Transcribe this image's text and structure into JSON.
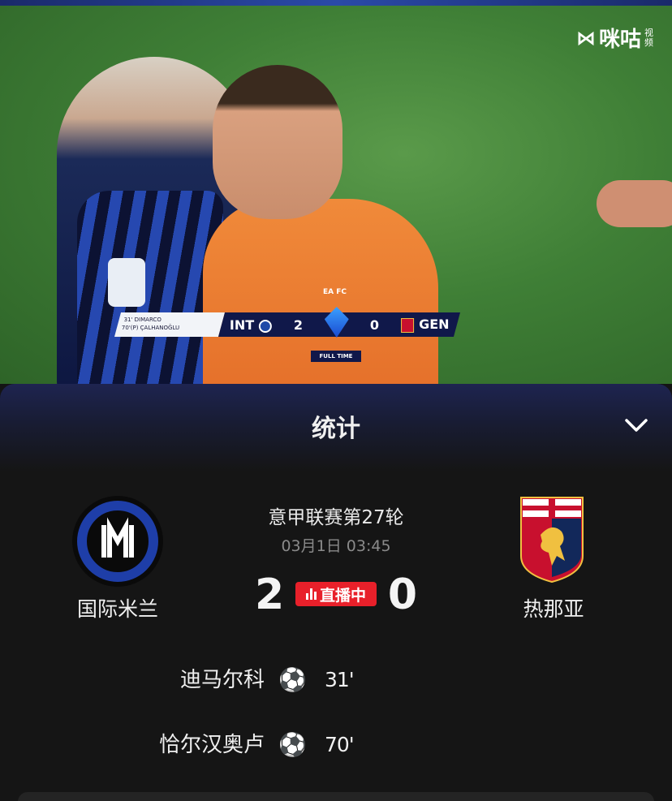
{
  "video": {
    "brand_text": "咪咕",
    "brand_sub": "视频",
    "scorebug": {
      "scorer1": "31'  DIMARCO",
      "scorer2": "70'(P)  ÇALHANOĞLU",
      "home_code": "INT",
      "home_score": "2",
      "away_score": "0",
      "away_code": "GEN",
      "status": "FULL TIME"
    }
  },
  "panel": {
    "title": "统计",
    "collapse_icon": "chevron-down-icon"
  },
  "match": {
    "competition": "意甲联赛第27轮",
    "datetime": "03月1日 03:45",
    "home_team": "国际米兰",
    "away_team": "热那亚",
    "home_score": "2",
    "away_score": "0",
    "live_label": "直播中",
    "colors": {
      "live": "#e8202a",
      "inter_blue": "#1e3ea8",
      "genoa_red": "#c8102e"
    }
  },
  "events": [
    {
      "scorer": "迪马尔科",
      "icon": "soccer-ball-icon",
      "minute": "31'"
    },
    {
      "scorer": "恰尔汉奥卢",
      "icon": "soccer-ball-icon",
      "minute": "70'"
    }
  ]
}
